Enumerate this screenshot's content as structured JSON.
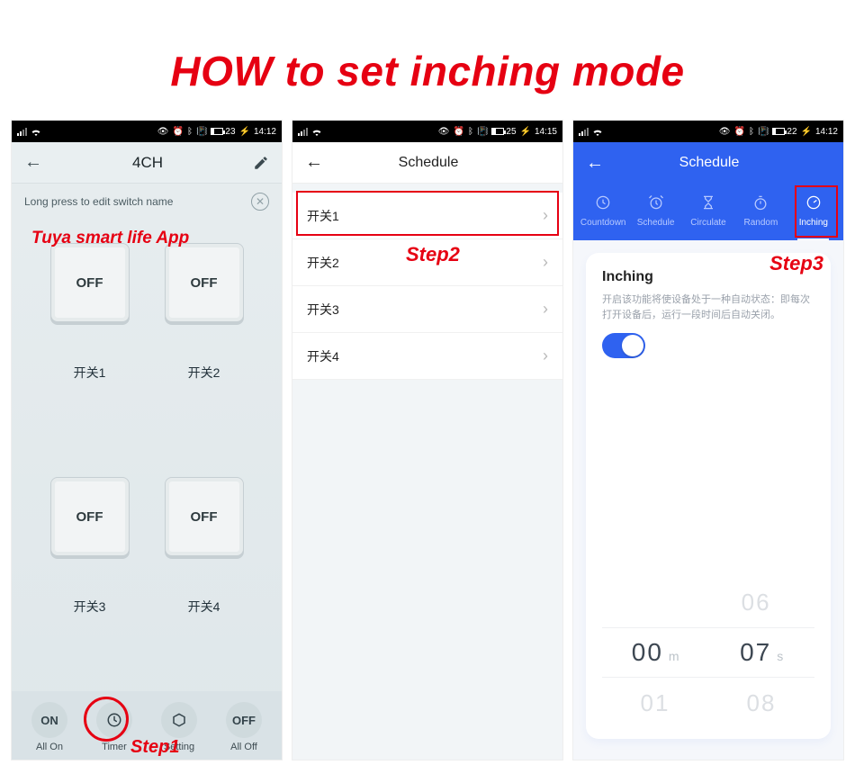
{
  "page_title": "HOW to set inching mode",
  "status": {
    "battery_pct": "23",
    "battery_pct2": "25",
    "battery_pct3": "22",
    "time1": "14:12",
    "time2": "14:15",
    "time3": "14:12",
    "charging_glyph": "⚡"
  },
  "annotations": {
    "app": "Tuya smart life  App",
    "step1": "Step1",
    "step2": "Step2",
    "step3": "Step3"
  },
  "screen1": {
    "title": "4CH",
    "tip": "Long press to edit switch name",
    "switches": [
      {
        "state": "OFF",
        "name": "开关1"
      },
      {
        "state": "OFF",
        "name": "开关2"
      },
      {
        "state": "OFF",
        "name": "开关3"
      },
      {
        "state": "OFF",
        "name": "开关4"
      }
    ],
    "footer": {
      "all_on": "ON",
      "all_on_lbl": "All On",
      "timer_lbl": "Timer",
      "setting_lbl": "Setting",
      "all_off": "OFF",
      "all_off_lbl": "All Off"
    }
  },
  "screen2": {
    "title": "Schedule",
    "items": [
      "开关1",
      "开关2",
      "开关3",
      "开关4"
    ]
  },
  "screen3": {
    "title": "Schedule",
    "tabs": [
      "Countdown",
      "Schedule",
      "Circulate",
      "Random",
      "Inching"
    ],
    "card_title": "Inching",
    "card_desc": "开启该功能将使设备处于一种自动状态：即每次打开设备后，运行一段时间后自动关闭。",
    "picker": {
      "minutes": "00",
      "m_unit": "m",
      "seconds": "07",
      "s_unit": "s",
      "above_sec": "06",
      "below_min": "01",
      "below_sec": "08"
    }
  }
}
